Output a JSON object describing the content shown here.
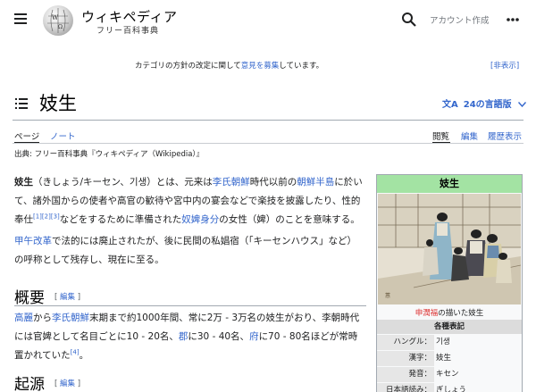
{
  "header": {
    "wordmark": "ウィキペディア",
    "tagline": "フリー百科事典",
    "account": "アカウント作成"
  },
  "notice": {
    "before": "カテゴリの方針の改定に関して",
    "link": "意見を募集",
    "after": "しています。",
    "hide": "[非表示]"
  },
  "title": {
    "text": "妓生",
    "languages": "24の言語版"
  },
  "tabs": {
    "page": "ページ",
    "note": "ノート",
    "read": "閲覧",
    "edit": "編集",
    "history": "履歴表示"
  },
  "from_line": "出典: フリー百科事典『ウィキペディア（Wikipedia）』",
  "intro": {
    "p1_a": "妓生",
    "p1_b": "（きしょう/キーセン、기생）とは、元来は",
    "p1_link1": "李氏朝鮮",
    "p1_c": "時代以前の",
    "p1_link2": "朝鮮半島",
    "p1_d": "に於いて、諸外国からの使者や高官の歓待や宮中内の宴会などで楽技を披露したり、性的奉仕",
    "ref1": "[1]",
    "ref2": "[2]",
    "ref3": "[3]",
    "p1_e": "などをするために準備された",
    "p1_link3": "奴婢",
    "p1_link4": "身分",
    "p1_f": "の女性（婢）のことを意味する。",
    "p2_link1": "甲午改革",
    "p2_a": "で法的には廃止されたが、後に民間の私娼宿（「キーセンハウス」など）の呼称として残存し、現在に至る。"
  },
  "sections": {
    "overview": "概要",
    "origin": "起源",
    "edit_label": "編集"
  },
  "overview": {
    "link1": "高麗",
    "a": "から",
    "link2": "李氏朝鮮",
    "b": "末期まで約1000年間、常に2万 - 3万名の妓生がおり、李朝時代には官婢として名目ごとに10 - 20名、",
    "link3": "郡",
    "c": "に30 - 40名、",
    "link4": "府",
    "d": "に70 - 80名ほどが常時置かれていた",
    "ref4": "[4]",
    "e": "。"
  },
  "infobox": {
    "title": "妓生",
    "caption_link": "申潤福",
    "caption_text": "の描いた妓生",
    "section": "各種表記",
    "rows": [
      {
        "k": "ハングル：",
        "v": "기생"
      },
      {
        "k": "漢字：",
        "v": "妓生"
      },
      {
        "k": "発音：",
        "v": "キセン"
      },
      {
        "k": "日本語読み：",
        "v": "ぎしょう"
      }
    ]
  },
  "colors": {
    "link": "#3366cc",
    "infobox_header": "#a3e3a3",
    "rule": "#a2a9b1"
  },
  "icons": [
    "menu-icon",
    "wikipedia-globe-icon",
    "search-icon",
    "more-icon",
    "toc-icon",
    "language-icon",
    "chevron-down-icon"
  ]
}
